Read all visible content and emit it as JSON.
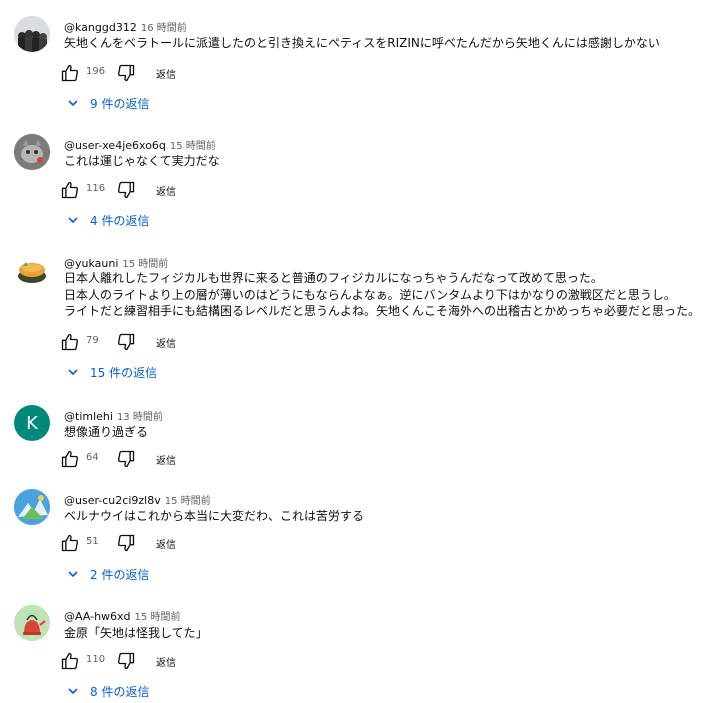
{
  "colors": {
    "link": "#065fd4",
    "secondary_text": "#606060",
    "text": "#0f0f0f"
  },
  "comments": [
    {
      "author": "@kanggd312",
      "time": "16 時間前",
      "lines": [
        "矢地くんをベラトールに派遣したのと引き換えにペティスをRIZINに呼べたんだから矢地くんには感謝しかない"
      ],
      "likes": "196",
      "reply_label": "返信",
      "replies_label": "9 件の返信"
    },
    {
      "author": "@user-xe4je6xo6q",
      "time": "15 時間前",
      "lines": [
        "これは運じゃなくて実力だな"
      ],
      "likes": "116",
      "reply_label": "返信",
      "replies_label": "4 件の返信"
    },
    {
      "author": "@yukauni",
      "time": "15 時間前",
      "lines": [
        "日本人離れしたフィジカルも世界に来ると普通のフィジカルになっちゃうんだなって改めて思った。",
        "日本人のライトより上の層が薄いのはどうにもならんよなぁ。逆にバンタムより下はかなりの激戦区だと思うし。",
        "ライトだと練習相手にも結構困るレベルだと思うんよね。矢地くんこそ海外への出稽古とかめっちゃ必要だと思った。"
      ],
      "likes": "79",
      "reply_label": "返信",
      "replies_label": "15 件の返信"
    },
    {
      "author": "@timlehi",
      "time": "13 時間前",
      "lines": [
        "想像通り過ぎる"
      ],
      "likes": "64",
      "reply_label": "返信",
      "avatar_letter": "K"
    },
    {
      "author": "@user-cu2ci9zl8v",
      "time": "15 時間前",
      "lines": [
        "ベルナウイはこれから本当に大変だわ、これは苦労する"
      ],
      "likes": "51",
      "reply_label": "返信",
      "replies_label": "2 件の返信"
    },
    {
      "author": "@AA-hw6xd",
      "time": "15 時間前",
      "lines": [
        "金原「矢地は怪我してた」"
      ],
      "likes": "110",
      "reply_label": "返信",
      "replies_label": "8 件の返信"
    }
  ]
}
